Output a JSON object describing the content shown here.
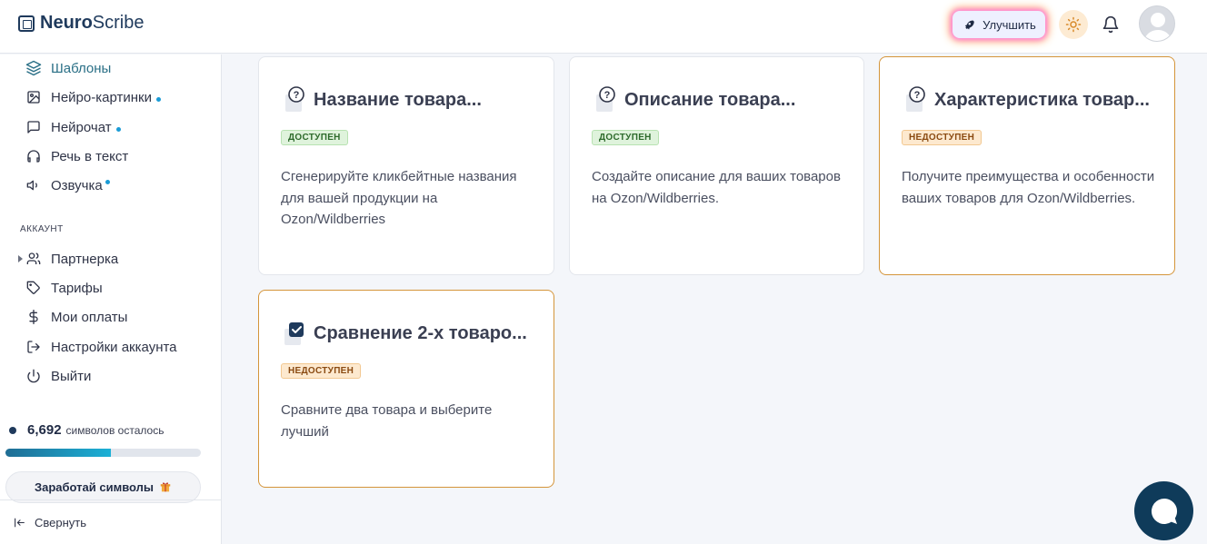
{
  "header": {
    "logo_bold": "Neuro",
    "logo_rest": "Scribe",
    "upgrade_label": "Улучшить"
  },
  "sidebar": {
    "items": [
      {
        "label": "Шаблоны",
        "icon": "layers-icon",
        "active": true
      },
      {
        "label": "Нейро-картинки",
        "icon": "image-icon",
        "dot": true
      },
      {
        "label": "Нейрочат",
        "icon": "chat-bubble-icon",
        "dot": true
      },
      {
        "label": "Речь в текст",
        "icon": "headphones-icon"
      },
      {
        "label": "Озвучка",
        "icon": "speaker-icon",
        "dot": true
      }
    ],
    "account_label": "АККАУНТ",
    "account_items": [
      {
        "label": "Партнерка",
        "icon": "users-icon"
      },
      {
        "label": "Тарифы",
        "icon": "tag-icon"
      },
      {
        "label": "Мои оплаты",
        "icon": "dollar-icon"
      },
      {
        "label": "Настройки аккаунта",
        "icon": "logout-arrow-icon"
      },
      {
        "label": "Выйти",
        "icon": "power-icon"
      }
    ],
    "credits_value": "6,692",
    "credits_text": "символов осталось",
    "credits_progress_fraction": 0.54,
    "earn_label": "Заработай символы",
    "collapse_label": "Свернуть"
  },
  "cards": [
    {
      "title": "Название товара...",
      "status": "ДОСТУПЕН",
      "available": true,
      "description": "Сгенерируйте кликбейтные названия для вашей продукции на Ozon/Wildberries",
      "icon": "question-doc-icon"
    },
    {
      "title": "Описание товара...",
      "status": "ДОСТУПЕН",
      "available": true,
      "description": "Создайте описание для ваших товаров на Ozon/Wildberries.",
      "icon": "question-doc-icon"
    },
    {
      "title": "Характеристика товар...",
      "status": "НЕДОСТУПЕН",
      "available": false,
      "description": "Получите преимущества и особенности ваших товаров для Ozon/Wildberries.",
      "icon": "question-doc-icon"
    },
    {
      "title": "Сравнение 2-х товаро...",
      "status": "НЕДОСТУПЕН",
      "available": false,
      "description": "Сравните два товара и выберите лучший",
      "icon": "checkbox-doc-icon"
    }
  ],
  "colors": {
    "accent": "#1f3a5c",
    "available_badge": "#dff3dc",
    "unavailable_badge": "#fde9cf",
    "unavailable_border": "#d4953a"
  }
}
